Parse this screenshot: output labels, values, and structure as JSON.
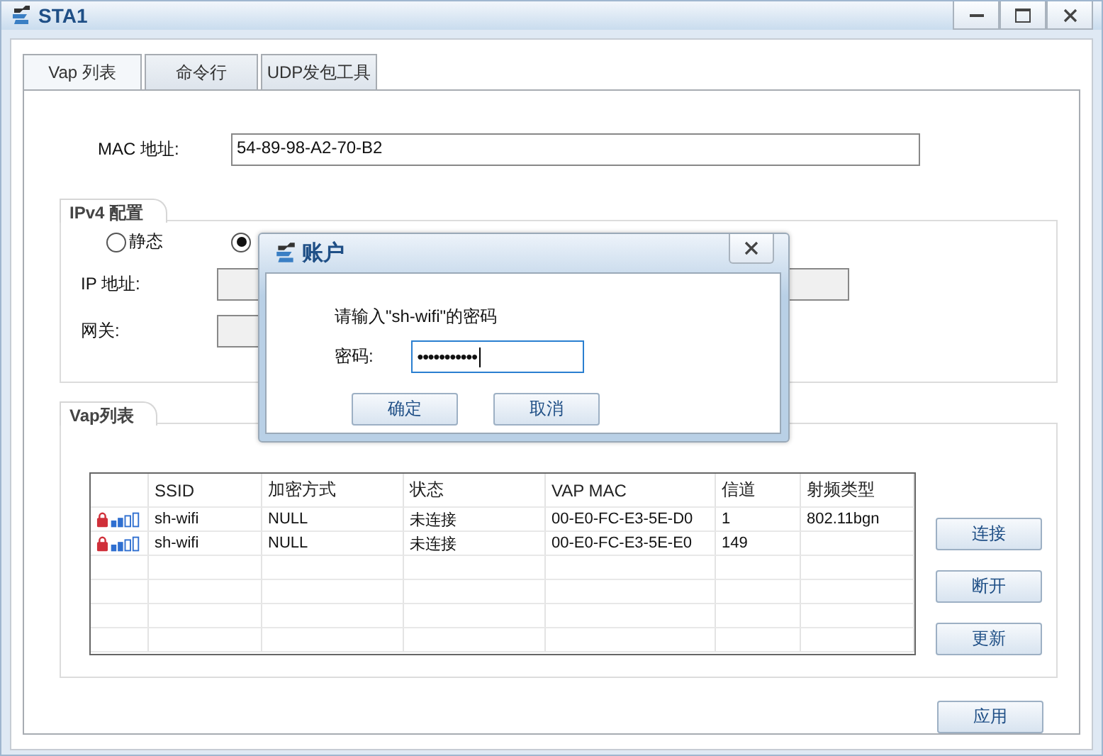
{
  "window": {
    "title": "STA1"
  },
  "tabs": [
    {
      "label": "Vap 列表",
      "selected": true
    },
    {
      "label": "命令行",
      "selected": false
    },
    {
      "label": "UDP发包工具",
      "selected": false
    }
  ],
  "mac": {
    "label": "MAC 地址:",
    "value": "54-89-98-A2-70-B2"
  },
  "ipv4": {
    "title": "IPv4 配置",
    "modes": [
      {
        "label": "静态",
        "selected": false
      },
      {
        "selected": true
      }
    ],
    "ip_label": "IP 地址:",
    "gateway_label": "网关:"
  },
  "vap": {
    "title": "Vap列表",
    "columns": [
      "SSID",
      "加密方式",
      "状态",
      "VAP MAC",
      "信道",
      "射频类型"
    ],
    "rows": [
      {
        "locked": true,
        "cells": [
          "sh-wifi",
          "NULL",
          "未连接",
          "00-E0-FC-E3-5E-D0",
          "1",
          "802.11bgn"
        ]
      },
      {
        "locked": true,
        "cells": [
          "sh-wifi",
          "NULL",
          "未连接",
          "00-E0-FC-E3-5E-E0",
          "149",
          ""
        ]
      }
    ],
    "buttons": [
      "连接",
      "断开",
      "更新"
    ]
  },
  "apply_button": "应用",
  "dialog": {
    "title": "账户",
    "prompt": "请输入\"sh-wifi\"的密码",
    "password_label": "密码:",
    "password_mask": "●●●●●●●●●●●",
    "buttons": [
      "确定",
      "取消"
    ]
  }
}
